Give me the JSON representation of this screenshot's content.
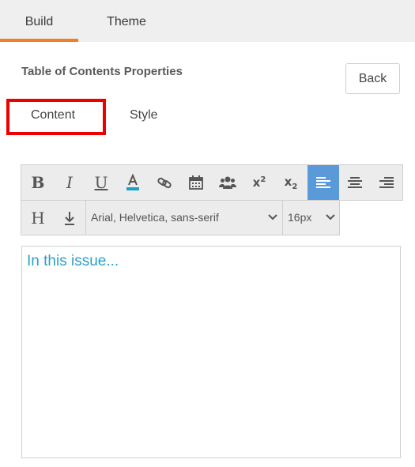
{
  "main_tabs": [
    {
      "label": "Build",
      "active": true
    },
    {
      "label": "Theme",
      "active": false
    }
  ],
  "panel": {
    "title": "Table of Contents Properties",
    "back_label": "Back"
  },
  "sub_tabs": [
    {
      "label": "Content",
      "highlighted": true
    },
    {
      "label": "Style",
      "highlighted": false
    }
  ],
  "toolbar": {
    "row1_icons": [
      "bold-icon",
      "italic-icon",
      "underline-icon",
      "text-color-icon",
      "link-icon",
      "calendar-icon",
      "users-icon",
      "superscript-icon",
      "subscript-icon",
      "align-left-icon",
      "align-center-icon",
      "align-right-icon"
    ],
    "row2_icons": [
      "heading-icon",
      "line-height-icon"
    ],
    "active_alignment": "align-left",
    "text_color_accent": "#17a2c8",
    "font_family": "Arial, Helvetica, sans-serif",
    "font_size": "16px"
  },
  "editor": {
    "content": "In this issue...",
    "text_color": "#2aa0c8"
  },
  "colors": {
    "accent_orange": "#ef7f2a",
    "highlight_red": "#ee0000",
    "active_button": "#5b9ad8"
  }
}
